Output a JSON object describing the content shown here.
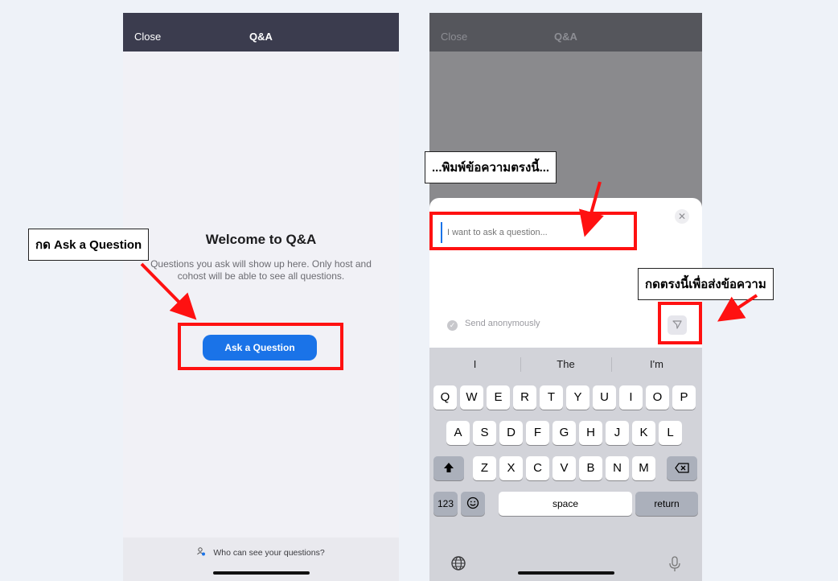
{
  "left_phone": {
    "nav": {
      "close_label": "Close",
      "title": "Q&A"
    },
    "welcome_title": "Welcome to Q&A",
    "welcome_body": "Questions you ask will show up here. Only host and cohost will be able to see all questions.",
    "ask_button_label": "Ask a Question",
    "footer_text": "Who can see your questions?"
  },
  "right_phone": {
    "nav": {
      "close_label": "Close",
      "title": "Q&A"
    },
    "input_placeholder": "I want to ask a question...",
    "anonymous_label": "Send anonymously",
    "suggestions": [
      "I",
      "The",
      "I'm"
    ],
    "keys_row1": [
      "Q",
      "W",
      "E",
      "R",
      "T",
      "Y",
      "U",
      "I",
      "O",
      "P"
    ],
    "keys_row2": [
      "A",
      "S",
      "D",
      "F",
      "G",
      "H",
      "J",
      "K",
      "L"
    ],
    "keys_row3": [
      "Z",
      "X",
      "C",
      "V",
      "B",
      "N",
      "M"
    ],
    "numbers_key": "123",
    "space_key": "space",
    "return_key": "return"
  },
  "annotations": {
    "ask_callout": "กด Ask a Question",
    "type_callout": "...พิมพ์ข้อความตรงนี้...",
    "send_callout": "กดตรงนี้เพื่อส่งข้อความ"
  },
  "colors": {
    "nav_bar": "#3b3c4e",
    "accent_button": "#1a73e8",
    "highlight_red": "#ff1111"
  }
}
